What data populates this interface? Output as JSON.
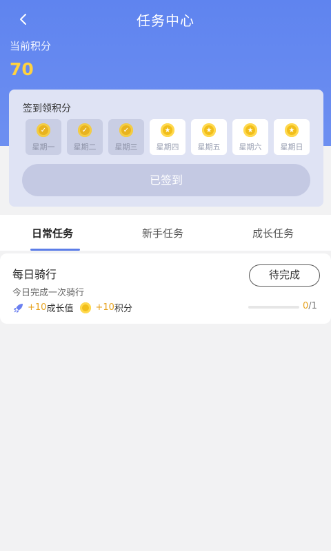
{
  "header": {
    "title": "任务中心",
    "back_icon": "chevron-left-icon",
    "background_color": "#6a8cf0"
  },
  "points": {
    "label": "当前积分",
    "value": "70"
  },
  "signin": {
    "title": "签到领积分",
    "days": [
      {
        "label": "星期一",
        "status": "signed"
      },
      {
        "label": "星期二",
        "status": "signed"
      },
      {
        "label": "星期三",
        "status": "signed"
      },
      {
        "label": "星期四",
        "status": "unsigned"
      },
      {
        "label": "星期五",
        "status": "unsigned"
      },
      {
        "label": "星期六",
        "status": "unsigned"
      },
      {
        "label": "星期日",
        "status": "unsigned"
      }
    ],
    "button_label": "已签到"
  },
  "tabs": [
    {
      "label": "日常任务",
      "active": true
    },
    {
      "label": "新手任务",
      "active": false
    },
    {
      "label": "成长任务",
      "active": false
    }
  ],
  "tasks": [
    {
      "name": "每日骑行",
      "description": "今日完成一次骑行",
      "rewards": [
        {
          "icon": "rocket-icon",
          "value": "+10",
          "unit": "成长值"
        },
        {
          "icon": "coin-icon",
          "value": "+10",
          "unit": "积分"
        }
      ],
      "action_label": "待完成",
      "progress": {
        "current": "0",
        "total": "/1",
        "fraction": 0
      }
    }
  ]
}
